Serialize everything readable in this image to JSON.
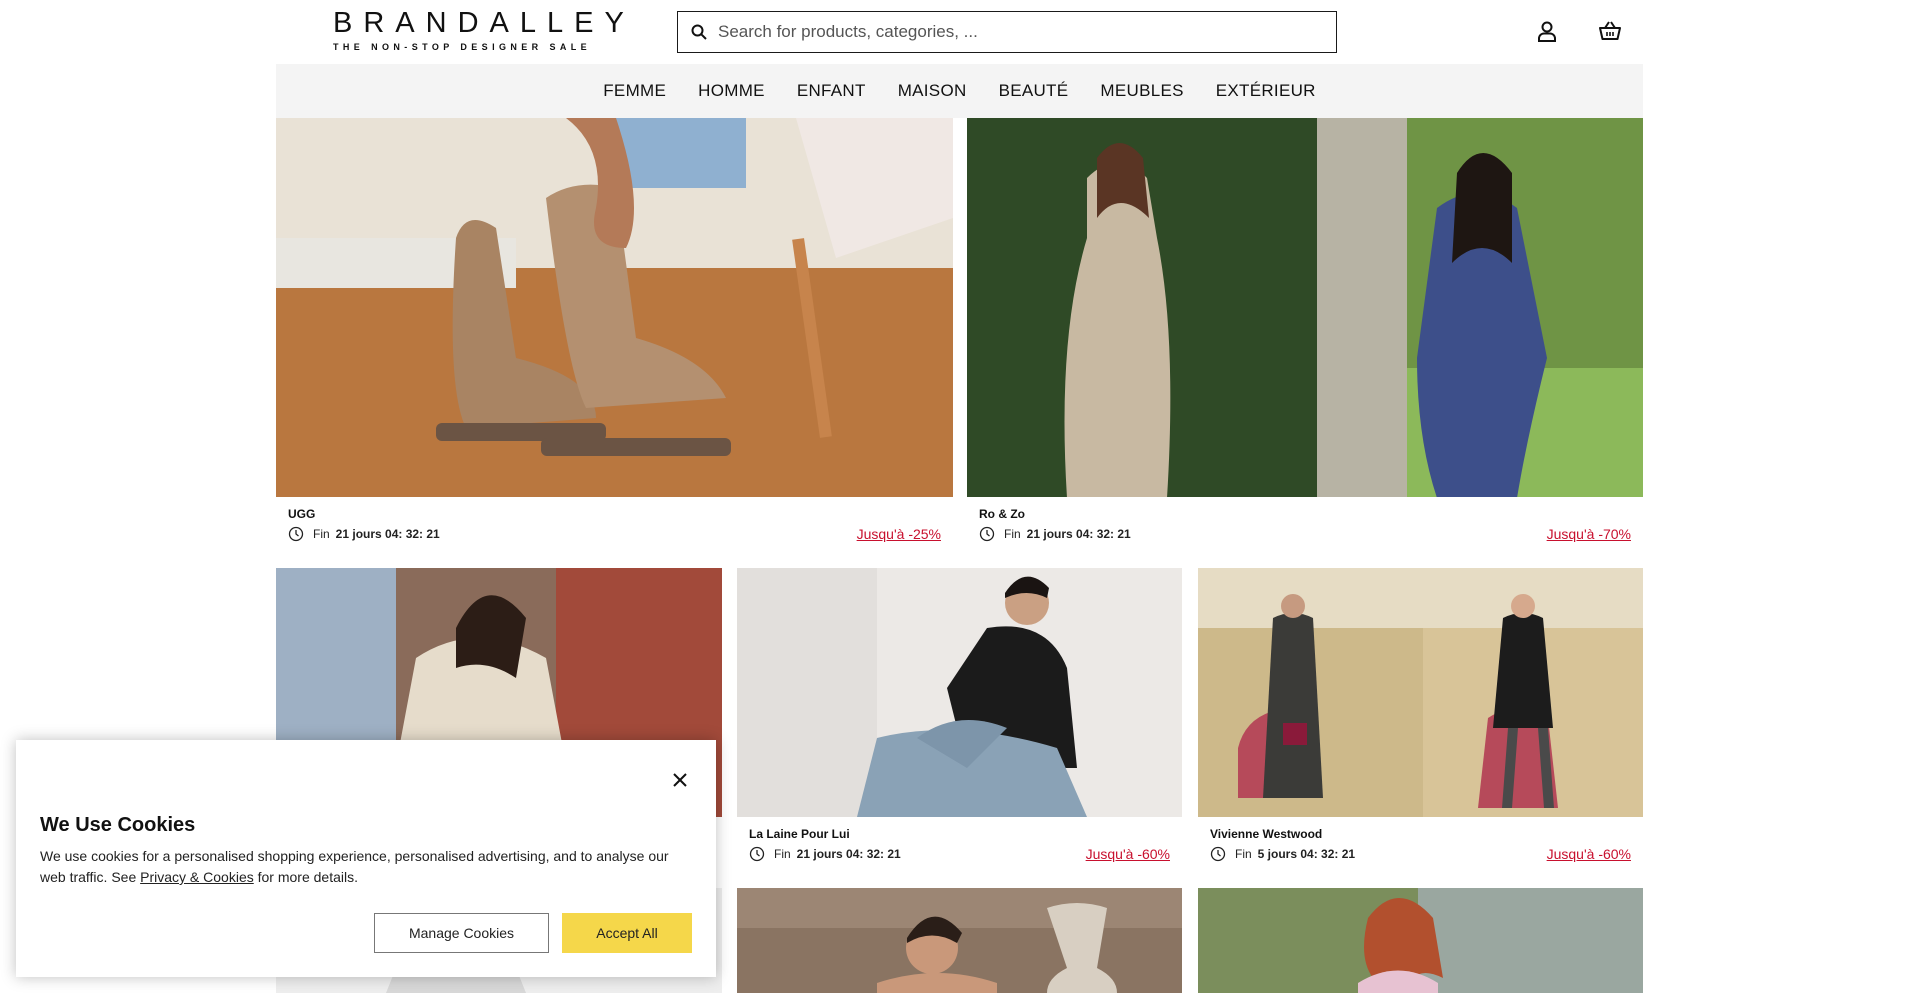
{
  "header": {
    "logo_main": "BRANDALLEY",
    "logo_sub": "THE NON-STOP DESIGNER SALE",
    "search_placeholder": "Search for products, categories, ...",
    "icons": [
      "search-icon",
      "user-icon",
      "basket-icon"
    ]
  },
  "nav": {
    "items": [
      {
        "label": "FEMME"
      },
      {
        "label": "HOMME"
      },
      {
        "label": "ENFANT"
      },
      {
        "label": "MAISON"
      },
      {
        "label": "BEAUTÉ"
      },
      {
        "label": "MEUBLES"
      },
      {
        "label": "EXTÉRIEUR"
      }
    ]
  },
  "sales": [
    {
      "brand": "UGG",
      "fin": "Fin",
      "time": "21 jours 04: 32: 21",
      "discount": "Jusqu'à -25%"
    },
    {
      "brand": "Ro & Zo",
      "fin": "Fin",
      "time": "21 jours 04: 32: 21",
      "discount": "Jusqu'à -70%"
    },
    {
      "brand": "",
      "fin": "",
      "time": "",
      "discount": ""
    },
    {
      "brand": "La Laine Pour Lui",
      "fin": "Fin",
      "time": "21 jours 04: 32: 21",
      "discount": "Jusqu'à -60%"
    },
    {
      "brand": "Vivienne Westwood",
      "fin": "Fin",
      "time": "5 jours 04: 32: 21",
      "discount": "Jusqu'à -60%"
    }
  ],
  "cookie": {
    "title": "We Use Cookies",
    "text_before": "We use cookies for a personalised shopping experience, personalised advertising, and to analyse our web traffic. See ",
    "link": "Privacy & Cookies",
    "text_after": " for more details.",
    "manage_label": "Manage Cookies",
    "accept_label": "Accept All"
  },
  "colors": {
    "discount": "#c8102e",
    "accept_button": "#f5d74a",
    "nav_background": "#f4f4f4"
  }
}
